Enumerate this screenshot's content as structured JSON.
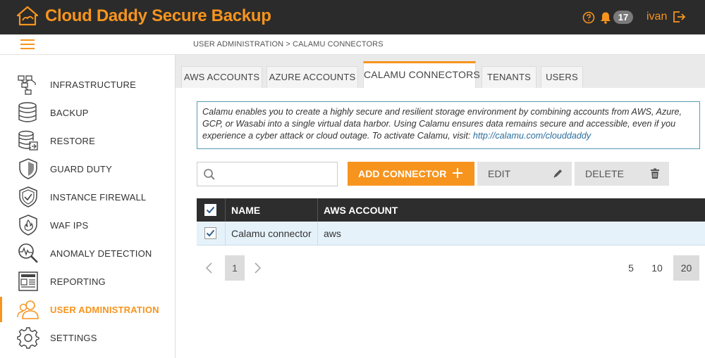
{
  "app": {
    "title": "Cloud Daddy Secure Backup"
  },
  "header": {
    "notification_count": "17",
    "username": "ivan"
  },
  "breadcrumb": "USER ADMINISTRATION > CALAMU CONNECTORS",
  "sidebar": {
    "items": [
      {
        "label": "INFRASTRUCTURE",
        "icon": "infrastructure-icon"
      },
      {
        "label": "BACKUP",
        "icon": "database-icon"
      },
      {
        "label": "RESTORE",
        "icon": "restore-icon"
      },
      {
        "label": "GUARD DUTY",
        "icon": "shield-icon"
      },
      {
        "label": "INSTANCE FIREWALL",
        "icon": "shield-check-icon"
      },
      {
        "label": "WAF IPS",
        "icon": "shield-fire-icon"
      },
      {
        "label": "ANOMALY DETECTION",
        "icon": "magnifier-pulse-icon"
      },
      {
        "label": "REPORTING",
        "icon": "newspaper-icon"
      },
      {
        "label": "USER ADMINISTRATION",
        "icon": "users-icon"
      },
      {
        "label": "SETTINGS",
        "icon": "gear-icon"
      }
    ],
    "active_index": 8
  },
  "tabs": [
    {
      "label": "AWS ACCOUNTS"
    },
    {
      "label": "AZURE ACCOUNTS"
    },
    {
      "label": "CALAMU CONNECTORS"
    },
    {
      "label": "TENANTS"
    },
    {
      "label": "USERS"
    }
  ],
  "info": {
    "text": "Calamu enables you to create a highly secure and resilient storage environment by combining accounts from AWS, Azure, GCP, or Wasabi into a single virtual data harbor. Using Calamu ensures data remains secure and accessible, even if you experience a cyber attack or cloud outage. To activate Calamu, visit: ",
    "link": "http://calamu.com/clouddaddy"
  },
  "toolbar": {
    "search_value": "",
    "add_label": "ADD CONNECTOR",
    "edit_label": "EDIT",
    "delete_label": "DELETE"
  },
  "grid": {
    "columns": [
      "NAME",
      "AWS ACCOUNT"
    ],
    "rows": [
      {
        "name": "Calamu connector",
        "aws_account": "aws",
        "checked": true
      }
    ]
  },
  "pager": {
    "current_page": "1",
    "page_sizes": [
      "5",
      "10",
      "20"
    ],
    "selected_size": "20"
  },
  "colors": {
    "accent": "#f7941d",
    "header_bg": "#2b2b2b",
    "row_selected": "#e6f2fa"
  }
}
